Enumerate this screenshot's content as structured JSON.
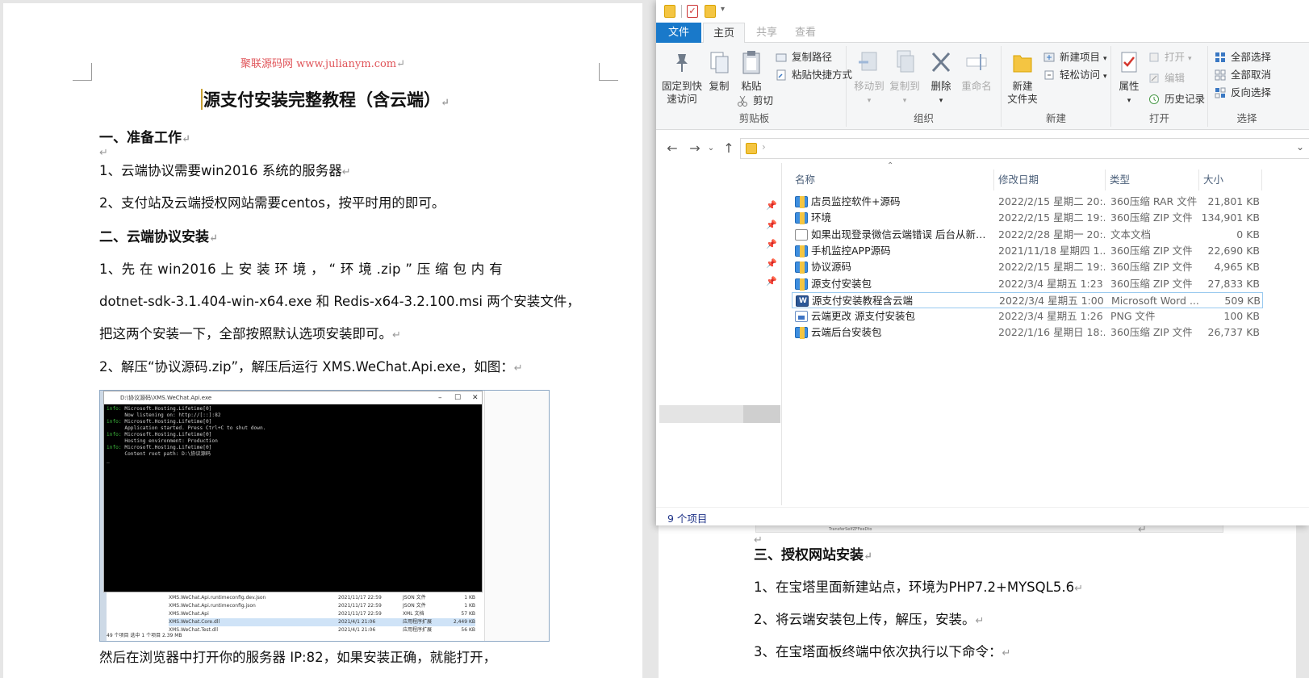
{
  "left_doc": {
    "header": "聚联源码网 www.julianym.com",
    "title": "源支付安装完整教程（含云端）",
    "section1": "一、准备工作",
    "s1_item1": "1、云端协议需要win2016 系统的服务器",
    "s1_item2": "2、支付站及云端授权网站需要centos，按平时用的即可。",
    "section2": "二、云端协议安装",
    "s2_item1_line1": "1、先 在 win2016 上 安 装 环 境 ， “ 环 境 .zip ” 压 缩 包 内 有",
    "s2_item1_line2": "dotnet-sdk-3.1.404-win-x64.exe 和 Redis-x64-3.2.100.msi 两个安装文件，",
    "s2_item1_line3": "把这两个安装一下，全部按照默认选项安装即可。",
    "s2_item2": "2、解压“协议源码.zip”，解压后运行 XMS.WeChat.Api.exe，如图：",
    "after_image": "然后在浏览器中打开你的服务器 IP:82，如果安装正确，就能打开，",
    "screenshot": {
      "window_title": "D:\\协议源码\\XMS.WeChat.Api.exe",
      "console_lines": [
        {
          "tag": "info:",
          "text": " Microsoft.Hosting.Lifetime[0]"
        },
        {
          "tag": "",
          "text": "      Now listening on: http://[::]:82"
        },
        {
          "tag": "info:",
          "text": " Microsoft.Hosting.Lifetime[0]"
        },
        {
          "tag": "",
          "text": "      Application started. Press Ctrl+C to shut down."
        },
        {
          "tag": "info:",
          "text": " Microsoft.Hosting.Lifetime[0]"
        },
        {
          "tag": "",
          "text": "      Hosting environment: Production"
        },
        {
          "tag": "info:",
          "text": " Microsoft.Hosting.Lifetime[0]"
        },
        {
          "tag": "",
          "text": "      Content root path: D:\\协议源码"
        }
      ],
      "files": [
        {
          "name": "XMS.WeChat.Api.runtimeconfig.dev.json",
          "date": "2021/11/17 22:59",
          "type": "JSON 文件",
          "size": "1 KB",
          "selected": false
        },
        {
          "name": "XMS.WeChat.Api.runtimeconfig.json",
          "date": "2021/11/17 22:59",
          "type": "JSON 文件",
          "size": "1 KB",
          "selected": false
        },
        {
          "name": "XMS.WeChat.Api",
          "date": "2021/11/17 22:59",
          "type": "XML 文档",
          "size": "57 KB",
          "selected": false
        },
        {
          "name": "XMS.WeChat.Core.dll",
          "date": "2021/4/1 21:06",
          "type": "应用程序扩展",
          "size": "2,449 KB",
          "selected": true
        },
        {
          "name": "XMS.WeChat.Test.dll",
          "date": "2021/4/1 21:06",
          "type": "应用程序扩展",
          "size": "56 KB",
          "selected": false
        }
      ],
      "status": "49 个项目    选中 1 个项目  2.39 MB"
    }
  },
  "right_doc": {
    "ghost_text": "TransferSelfZFFeeDto",
    "section3": "三、授权网站安装",
    "item1": "1、在宝塔里面新建站点，环境为PHP7.2+MYSQL5.6",
    "item2": "2、将云端安装包上传，解压，安装。",
    "item3": "3、在宝塔面板终端中依次执行以下命令："
  },
  "explorer": {
    "tabs": {
      "file": "文件",
      "home": "主页",
      "share": "共享",
      "view": "查看"
    },
    "ribbon": {
      "pin": "固定到快\n速访问",
      "copy": "复制",
      "paste": "粘贴",
      "copy_path": "复制路径",
      "paste_shortcut": "粘贴快捷方式",
      "cut": "剪切",
      "group_clipboard": "剪贴板",
      "move_to": "移动到",
      "copy_to": "复制到",
      "delete": "删除",
      "rename": "重命名",
      "group_organize": "组织",
      "new_folder": "新建\n文件夹",
      "new_item": "新建项目",
      "easy_access": "轻松访问",
      "group_new": "新建",
      "properties": "属性",
      "open": "打开",
      "edit": "编辑",
      "history": "历史记录",
      "group_open": "打开",
      "select_all": "全部选择",
      "select_none": "全部取消",
      "invert_select": "反向选择",
      "group_select": "选择"
    },
    "columns": {
      "name": "名称",
      "date": "修改日期",
      "type": "类型",
      "size": "大小"
    },
    "files": [
      {
        "name": "店员监控软件+源码",
        "date": "2022/2/15 星期二 20:...",
        "type": "360压缩 RAR 文件",
        "size": "21,801 KB",
        "icon": "zip"
      },
      {
        "name": "环境",
        "date": "2022/2/15 星期二 19:...",
        "type": "360压缩 ZIP 文件",
        "size": "134,901 KB",
        "icon": "zip"
      },
      {
        "name": "如果出现登录微信云端错误 后台从新添...",
        "date": "2022/2/28 星期一 20:...",
        "type": "文本文档",
        "size": "0 KB",
        "icon": "txt"
      },
      {
        "name": "手机监控APP源码",
        "date": "2021/11/18 星期四 1...",
        "type": "360压缩 ZIP 文件",
        "size": "22,690 KB",
        "icon": "zip"
      },
      {
        "name": "协议源码",
        "date": "2022/2/15 星期二 19:...",
        "type": "360压缩 ZIP 文件",
        "size": "4,965 KB",
        "icon": "zip"
      },
      {
        "name": "源支付安装包",
        "date": "2022/3/4 星期五 1:23",
        "type": "360压缩 ZIP 文件",
        "size": "27,833 KB",
        "icon": "zip"
      },
      {
        "name": "源支付安装教程含云端",
        "date": "2022/3/4 星期五 1:00",
        "type": "Microsoft Word ...",
        "size": "509 KB",
        "icon": "doc",
        "selected": true
      },
      {
        "name": "云端更改  源支付安装包",
        "date": "2022/3/4 星期五 1:26",
        "type": "PNG 文件",
        "size": "100 KB",
        "icon": "png"
      },
      {
        "name": "云端后台安装包",
        "date": "2022/1/16 星期日 18:...",
        "type": "360压缩 ZIP 文件",
        "size": "26,737 KB",
        "icon": "zip"
      }
    ],
    "status": "9 个项目"
  }
}
